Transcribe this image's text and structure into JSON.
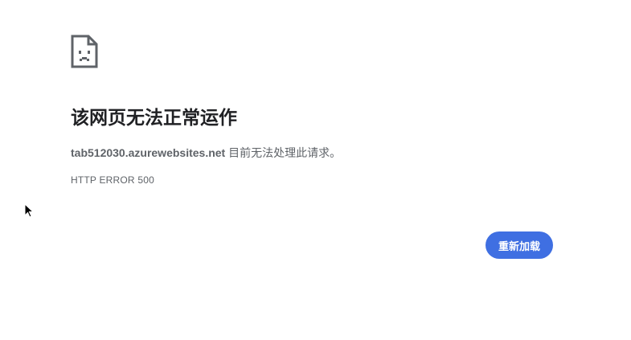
{
  "page": {
    "headline": "该网页无法正常运作",
    "message_host": "tab512030.azurewebsites.net",
    "message_text": " 目前无法处理此请求。",
    "error_code": "HTTP ERROR 500",
    "reload_label": "重新加载"
  },
  "icons": {
    "error": "sad-page-icon",
    "cursor": "mouse-pointer-icon"
  },
  "colors": {
    "accent": "#3f6fe2",
    "headline": "#202124",
    "body_text": "#5f6368",
    "background": "#ffffff"
  }
}
